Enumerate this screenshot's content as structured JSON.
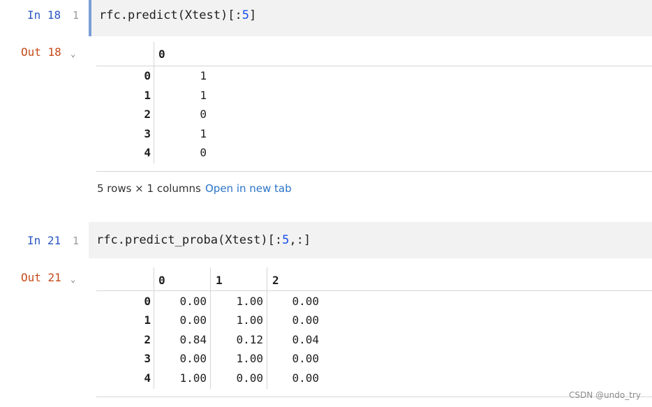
{
  "cells": [
    {
      "in_label": "In 18",
      "line_no": "1",
      "code_prefix": "rfc.predict(Xtest)[:",
      "code_num": "5",
      "code_suffix": "]",
      "out_label": "Out 18",
      "table": {
        "columns": [
          "0"
        ],
        "rows": [
          {
            "index": "0",
            "values": [
              "1"
            ]
          },
          {
            "index": "1",
            "values": [
              "1"
            ]
          },
          {
            "index": "2",
            "values": [
              "0"
            ]
          },
          {
            "index": "3",
            "values": [
              "1"
            ]
          },
          {
            "index": "4",
            "values": [
              "0"
            ]
          }
        ]
      },
      "footer_text": "5 rows × 1 columns",
      "footer_link": "Open in new tab"
    },
    {
      "in_label": "In 21",
      "line_no": "1",
      "code_prefix": "rfc.predict_proba(Xtest)[:",
      "code_num": "5",
      "code_suffix": ",:]",
      "out_label": "Out 21",
      "table": {
        "columns": [
          "0",
          "1",
          "2"
        ],
        "rows": [
          {
            "index": "0",
            "values": [
              "0.00",
              "1.00",
              "0.00"
            ]
          },
          {
            "index": "1",
            "values": [
              "0.00",
              "1.00",
              "0.00"
            ]
          },
          {
            "index": "2",
            "values": [
              "0.84",
              "0.12",
              "0.04"
            ]
          },
          {
            "index": "3",
            "values": [
              "0.00",
              "1.00",
              "0.00"
            ]
          },
          {
            "index": "4",
            "values": [
              "1.00",
              "0.00",
              "0.00"
            ]
          }
        ]
      }
    }
  ],
  "watermark": "CSDN @undo_try",
  "icons": {
    "collapse": "chevron-down-icon"
  }
}
